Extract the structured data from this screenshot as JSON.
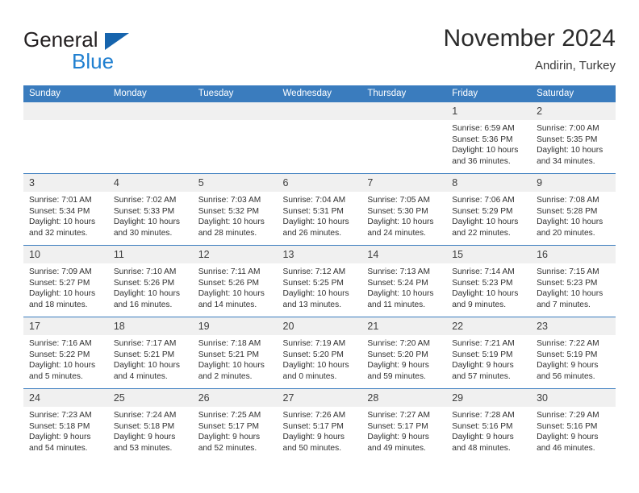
{
  "brand": {
    "word1": "General",
    "word2": "Blue",
    "triangle_icon": "blue-triangle-logo-icon"
  },
  "header": {
    "title": "November 2024",
    "location": "Andirin, Turkey"
  },
  "colors": {
    "header_blue": "#3a7cbe",
    "daynum_gray": "#f0f0f0",
    "brand_dark": "#231f20",
    "brand_blue": "#1f7fd0",
    "text": "#303030"
  },
  "weekday_headers": [
    "Sunday",
    "Monday",
    "Tuesday",
    "Wednesday",
    "Thursday",
    "Friday",
    "Saturday"
  ],
  "weeks": [
    [
      {
        "empty": true
      },
      {
        "empty": true
      },
      {
        "empty": true
      },
      {
        "empty": true
      },
      {
        "empty": true
      },
      {
        "day": "1",
        "sunrise": "Sunrise: 6:59 AM",
        "sunset": "Sunset: 5:36 PM",
        "daylight": "Daylight: 10 hours and 36 minutes."
      },
      {
        "day": "2",
        "sunrise": "Sunrise: 7:00 AM",
        "sunset": "Sunset: 5:35 PM",
        "daylight": "Daylight: 10 hours and 34 minutes."
      }
    ],
    [
      {
        "day": "3",
        "sunrise": "Sunrise: 7:01 AM",
        "sunset": "Sunset: 5:34 PM",
        "daylight": "Daylight: 10 hours and 32 minutes."
      },
      {
        "day": "4",
        "sunrise": "Sunrise: 7:02 AM",
        "sunset": "Sunset: 5:33 PM",
        "daylight": "Daylight: 10 hours and 30 minutes."
      },
      {
        "day": "5",
        "sunrise": "Sunrise: 7:03 AM",
        "sunset": "Sunset: 5:32 PM",
        "daylight": "Daylight: 10 hours and 28 minutes."
      },
      {
        "day": "6",
        "sunrise": "Sunrise: 7:04 AM",
        "sunset": "Sunset: 5:31 PM",
        "daylight": "Daylight: 10 hours and 26 minutes."
      },
      {
        "day": "7",
        "sunrise": "Sunrise: 7:05 AM",
        "sunset": "Sunset: 5:30 PM",
        "daylight": "Daylight: 10 hours and 24 minutes."
      },
      {
        "day": "8",
        "sunrise": "Sunrise: 7:06 AM",
        "sunset": "Sunset: 5:29 PM",
        "daylight": "Daylight: 10 hours and 22 minutes."
      },
      {
        "day": "9",
        "sunrise": "Sunrise: 7:08 AM",
        "sunset": "Sunset: 5:28 PM",
        "daylight": "Daylight: 10 hours and 20 minutes."
      }
    ],
    [
      {
        "day": "10",
        "sunrise": "Sunrise: 7:09 AM",
        "sunset": "Sunset: 5:27 PM",
        "daylight": "Daylight: 10 hours and 18 minutes."
      },
      {
        "day": "11",
        "sunrise": "Sunrise: 7:10 AM",
        "sunset": "Sunset: 5:26 PM",
        "daylight": "Daylight: 10 hours and 16 minutes."
      },
      {
        "day": "12",
        "sunrise": "Sunrise: 7:11 AM",
        "sunset": "Sunset: 5:26 PM",
        "daylight": "Daylight: 10 hours and 14 minutes."
      },
      {
        "day": "13",
        "sunrise": "Sunrise: 7:12 AM",
        "sunset": "Sunset: 5:25 PM",
        "daylight": "Daylight: 10 hours and 13 minutes."
      },
      {
        "day": "14",
        "sunrise": "Sunrise: 7:13 AM",
        "sunset": "Sunset: 5:24 PM",
        "daylight": "Daylight: 10 hours and 11 minutes."
      },
      {
        "day": "15",
        "sunrise": "Sunrise: 7:14 AM",
        "sunset": "Sunset: 5:23 PM",
        "daylight": "Daylight: 10 hours and 9 minutes."
      },
      {
        "day": "16",
        "sunrise": "Sunrise: 7:15 AM",
        "sunset": "Sunset: 5:23 PM",
        "daylight": "Daylight: 10 hours and 7 minutes."
      }
    ],
    [
      {
        "day": "17",
        "sunrise": "Sunrise: 7:16 AM",
        "sunset": "Sunset: 5:22 PM",
        "daylight": "Daylight: 10 hours and 5 minutes."
      },
      {
        "day": "18",
        "sunrise": "Sunrise: 7:17 AM",
        "sunset": "Sunset: 5:21 PM",
        "daylight": "Daylight: 10 hours and 4 minutes."
      },
      {
        "day": "19",
        "sunrise": "Sunrise: 7:18 AM",
        "sunset": "Sunset: 5:21 PM",
        "daylight": "Daylight: 10 hours and 2 minutes."
      },
      {
        "day": "20",
        "sunrise": "Sunrise: 7:19 AM",
        "sunset": "Sunset: 5:20 PM",
        "daylight": "Daylight: 10 hours and 0 minutes."
      },
      {
        "day": "21",
        "sunrise": "Sunrise: 7:20 AM",
        "sunset": "Sunset: 5:20 PM",
        "daylight": "Daylight: 9 hours and 59 minutes."
      },
      {
        "day": "22",
        "sunrise": "Sunrise: 7:21 AM",
        "sunset": "Sunset: 5:19 PM",
        "daylight": "Daylight: 9 hours and 57 minutes."
      },
      {
        "day": "23",
        "sunrise": "Sunrise: 7:22 AM",
        "sunset": "Sunset: 5:19 PM",
        "daylight": "Daylight: 9 hours and 56 minutes."
      }
    ],
    [
      {
        "day": "24",
        "sunrise": "Sunrise: 7:23 AM",
        "sunset": "Sunset: 5:18 PM",
        "daylight": "Daylight: 9 hours and 54 minutes."
      },
      {
        "day": "25",
        "sunrise": "Sunrise: 7:24 AM",
        "sunset": "Sunset: 5:18 PM",
        "daylight": "Daylight: 9 hours and 53 minutes."
      },
      {
        "day": "26",
        "sunrise": "Sunrise: 7:25 AM",
        "sunset": "Sunset: 5:17 PM",
        "daylight": "Daylight: 9 hours and 52 minutes."
      },
      {
        "day": "27",
        "sunrise": "Sunrise: 7:26 AM",
        "sunset": "Sunset: 5:17 PM",
        "daylight": "Daylight: 9 hours and 50 minutes."
      },
      {
        "day": "28",
        "sunrise": "Sunrise: 7:27 AM",
        "sunset": "Sunset: 5:17 PM",
        "daylight": "Daylight: 9 hours and 49 minutes."
      },
      {
        "day": "29",
        "sunrise": "Sunrise: 7:28 AM",
        "sunset": "Sunset: 5:16 PM",
        "daylight": "Daylight: 9 hours and 48 minutes."
      },
      {
        "day": "30",
        "sunrise": "Sunrise: 7:29 AM",
        "sunset": "Sunset: 5:16 PM",
        "daylight": "Daylight: 9 hours and 46 minutes."
      }
    ]
  ]
}
